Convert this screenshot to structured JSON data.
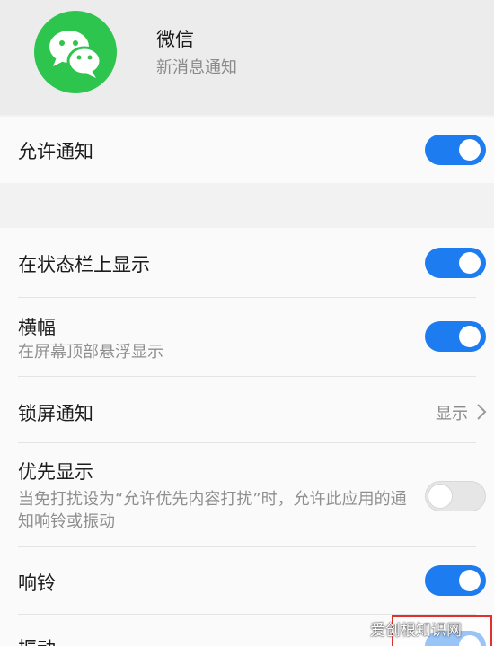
{
  "app": {
    "name": "微信",
    "subtitle": "新消息通知",
    "icon": "wechat-icon",
    "brand_color": "#2dc54d"
  },
  "accent_color": "#1c7cf0",
  "settings": {
    "allow": {
      "label": "允许通知",
      "enabled": true
    },
    "status_bar": {
      "label": "在状态栏上显示",
      "enabled": true
    },
    "banner": {
      "label": "横幅",
      "desc": "在屏幕顶部悬浮显示",
      "enabled": true
    },
    "lock_screen": {
      "label": "锁屏通知",
      "value": "显示",
      "icon": "chevron-right-icon"
    },
    "priority": {
      "label": "优先显示",
      "desc": "当免打扰设为“允许优先内容打扰”时，允许此应用的通知响铃或振动",
      "enabled": false
    },
    "ring": {
      "label": "响铃",
      "enabled": true
    },
    "vibrate": {
      "label": "振动",
      "enabled": true
    }
  },
  "watermark": {
    "text": "爱创根知识网"
  }
}
